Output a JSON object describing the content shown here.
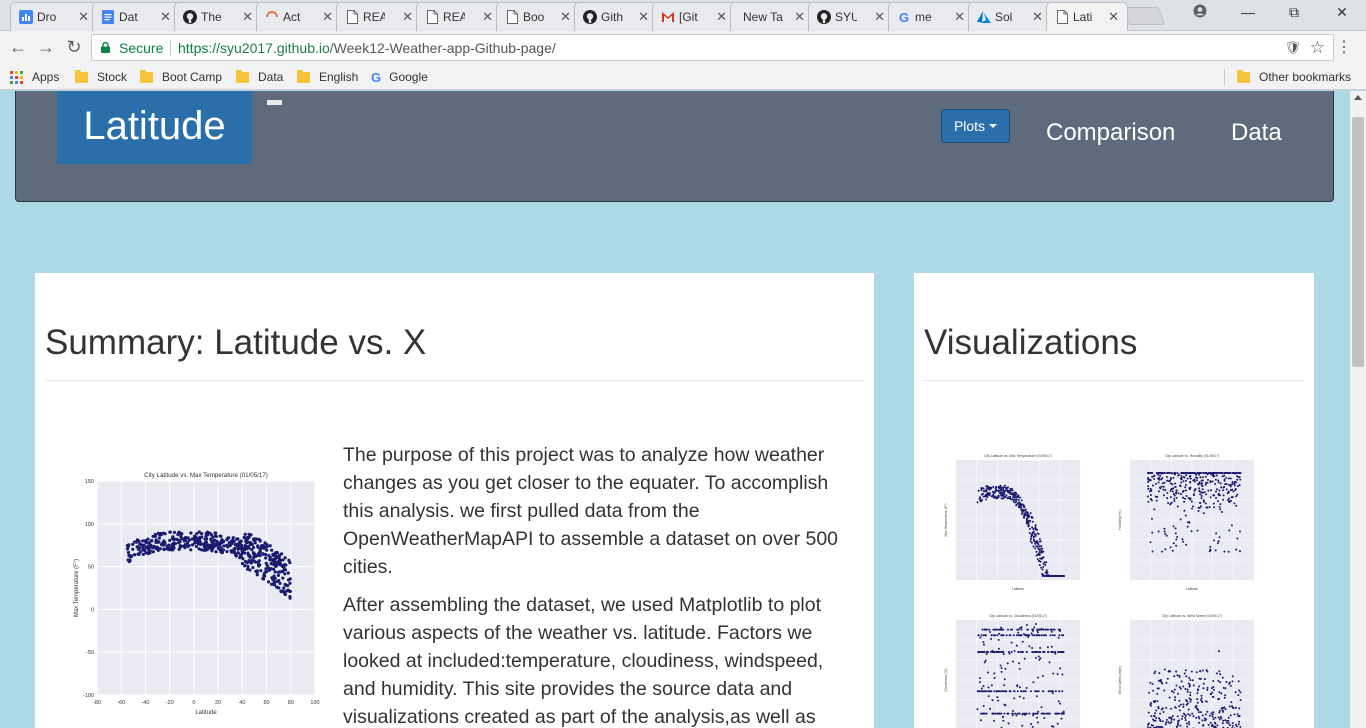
{
  "browser": {
    "tabs": [
      {
        "title": "Dro",
        "icon": "bar-chart-icon"
      },
      {
        "title": "Dat",
        "icon": "docs-icon"
      },
      {
        "title": "The",
        "icon": "github-icon"
      },
      {
        "title": "Act",
        "icon": "loading-icon"
      },
      {
        "title": "REA",
        "icon": "document-icon"
      },
      {
        "title": "REA",
        "icon": "document-icon"
      },
      {
        "title": "Boo",
        "icon": "document-icon"
      },
      {
        "title": "Gith",
        "icon": "github-icon"
      },
      {
        "title": "[Git",
        "icon": "gmail-icon"
      },
      {
        "title": "New Ta",
        "icon": "none"
      },
      {
        "title": "SYU",
        "icon": "github-icon"
      },
      {
        "title": "me",
        "icon": "google-icon"
      },
      {
        "title": "Sol",
        "icon": "azure-icon"
      },
      {
        "title": "Lati",
        "icon": "document-icon"
      }
    ],
    "secure_label": "Secure",
    "url_scheme": "https://",
    "url_host": "syu2017.github.io",
    "url_path": "/Week12-Weather-app-Github-page/",
    "bookmarks": {
      "apps": "Apps",
      "items": [
        "Stock",
        "Boot Camp",
        "Data",
        "English"
      ],
      "google": "Google",
      "other": "Other bookmarks"
    }
  },
  "navbar": {
    "brand": "Latitude",
    "plots_label": "Plots",
    "links": [
      "Comparison",
      "Data"
    ],
    "brand_color": "#2a6faa",
    "bar_color": "#5e6b7c"
  },
  "summary": {
    "title": "Summary: Latitude vs. X",
    "paragraphs": [
      "The purpose of this project was to analyze how weather changes as you get closer to the equater. To accomplish this analysis. we first pulled data from the OpenWeatherMapAPI to assemble a dataset on over 500 cities.",
      "After assembling the dataset, we used Matplotlib to plot various aspects of the weather vs. latitude. Factors we looked at included:temperature, cloudiness, windspeed, and humidity. This site provides the source data and visualizations created as part of the analysis,as well as"
    ]
  },
  "visualizations": {
    "title": "Visualizations"
  },
  "chart_data": [
    {
      "type": "scatter",
      "title": "City Latitude vs. Max Temperature (01/05/17)",
      "xlabel": "Latitude",
      "ylabel": "Max Temperature (F°)",
      "xlim": [
        -80,
        100
      ],
      "ylim": [
        -100,
        150
      ],
      "xticks": [
        "-80",
        "-60",
        "-40",
        "-20",
        "0",
        "20",
        "40",
        "60",
        "80",
        "100"
      ],
      "yticks": [
        "150",
        "100",
        "50",
        "0",
        "-50",
        "-100"
      ],
      "color": "#1a1a6e",
      "trend": "inverted parabola peaking near 80°F around latitude -20 to 10, falling to about -55°F near latitude 75"
    },
    {
      "type": "scatter",
      "title": "City Latitude vs. Max Temperature (01/05/17)",
      "xlabel": "Latitude",
      "ylabel": "Max Temperature (F°)",
      "color": "#1a1a6e"
    },
    {
      "type": "scatter",
      "title": "City Latitude vs. Humidity (01/05/17)",
      "xlabel": "Latitude",
      "ylabel": "Humidity (%)",
      "color": "#1a1a6e"
    },
    {
      "type": "scatter",
      "title": "City Latitude vs. Cloudiness (01/05/17)",
      "xlabel": "Latitude",
      "ylabel": "Cloudiness (%)",
      "color": "#1a1a6e"
    },
    {
      "type": "scatter",
      "title": "City Latitude vs. Wind Speed (01/05/17)",
      "xlabel": "Latitude",
      "ylabel": "Wind Speed (mph)",
      "color": "#1a1a6e"
    }
  ]
}
